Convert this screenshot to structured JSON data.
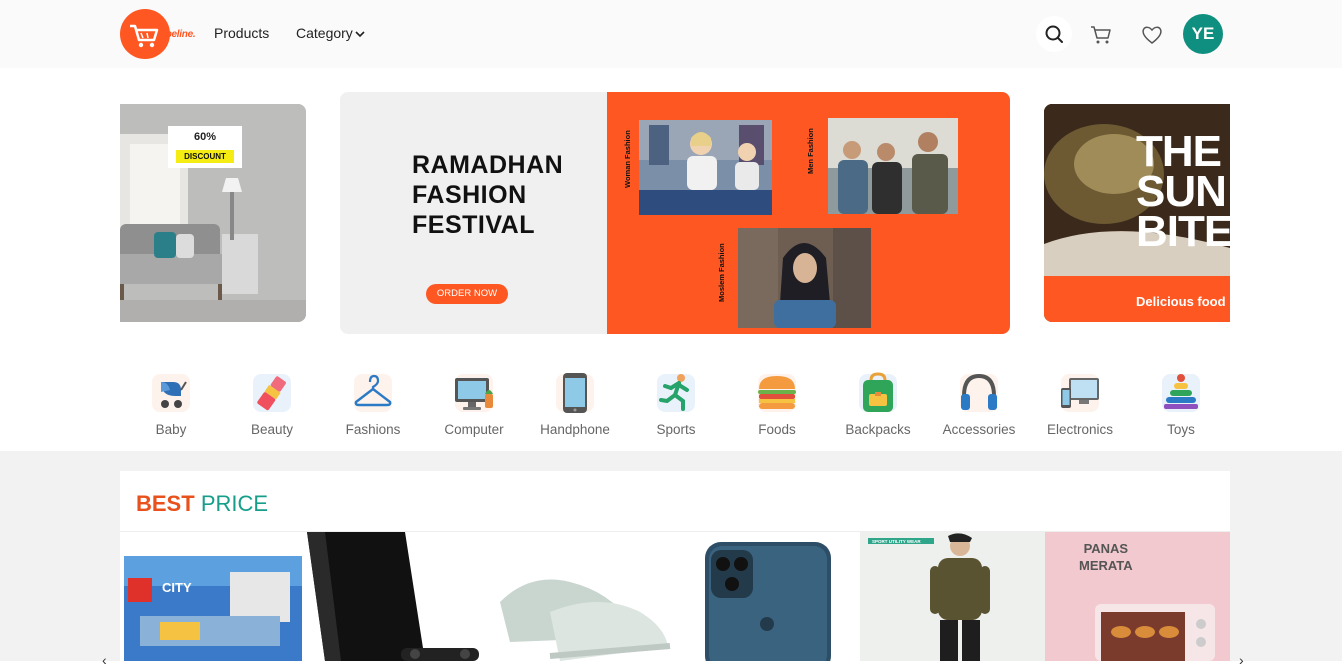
{
  "brand": {
    "logo_text": "albeline."
  },
  "nav": {
    "products": "Products",
    "category": "Category",
    "avatar_initials": "YE"
  },
  "carousel": {
    "left": {
      "percent": "60%",
      "label": "DISCOUNT"
    },
    "main": {
      "title_lines": [
        "RAMADHAN",
        "FASHION",
        "FESTIVAL"
      ],
      "button": "ORDER NOW",
      "labels": {
        "woman": "Woman Fashion",
        "men": "Men Fashion",
        "moslem": "Moslem Fashion"
      }
    },
    "right": {
      "title_lines": [
        "THE",
        "SUN",
        "BITE"
      ],
      "caption": "Delicious food"
    }
  },
  "categories": [
    {
      "label": "Baby",
      "icon": "stroller-icon"
    },
    {
      "label": "Beauty",
      "icon": "lipstick-icon"
    },
    {
      "label": "Fashions",
      "icon": "hanger-icon"
    },
    {
      "label": "Computer",
      "icon": "desktop-icon"
    },
    {
      "label": "Handphone",
      "icon": "phone-icon"
    },
    {
      "label": "Sports",
      "icon": "runner-icon"
    },
    {
      "label": "Foods",
      "icon": "burger-icon"
    },
    {
      "label": "Backpacks",
      "icon": "backpack-icon"
    },
    {
      "label": "Accessories",
      "icon": "headphones-icon"
    },
    {
      "label": "Electronics",
      "icon": "devices-icon"
    },
    {
      "label": "Toys",
      "icon": "toy-stack-icon"
    }
  ],
  "best_price": {
    "title_bold": "BEST",
    "title_rest": "PRICE",
    "products": [
      {
        "name": "lego-city",
        "brand_text": "CITY"
      },
      {
        "name": "playstation-console"
      },
      {
        "name": "sneakers"
      },
      {
        "name": "iphone"
      },
      {
        "name": "hoodie-model",
        "tag": "SPORT UTILITY WEAR"
      },
      {
        "name": "oven",
        "title_lines": [
          "PANAS",
          "MERATA"
        ]
      }
    ]
  },
  "colors": {
    "accent": "#ff5722",
    "teal": "#169e8b",
    "avatar": "#0f8f7f"
  }
}
